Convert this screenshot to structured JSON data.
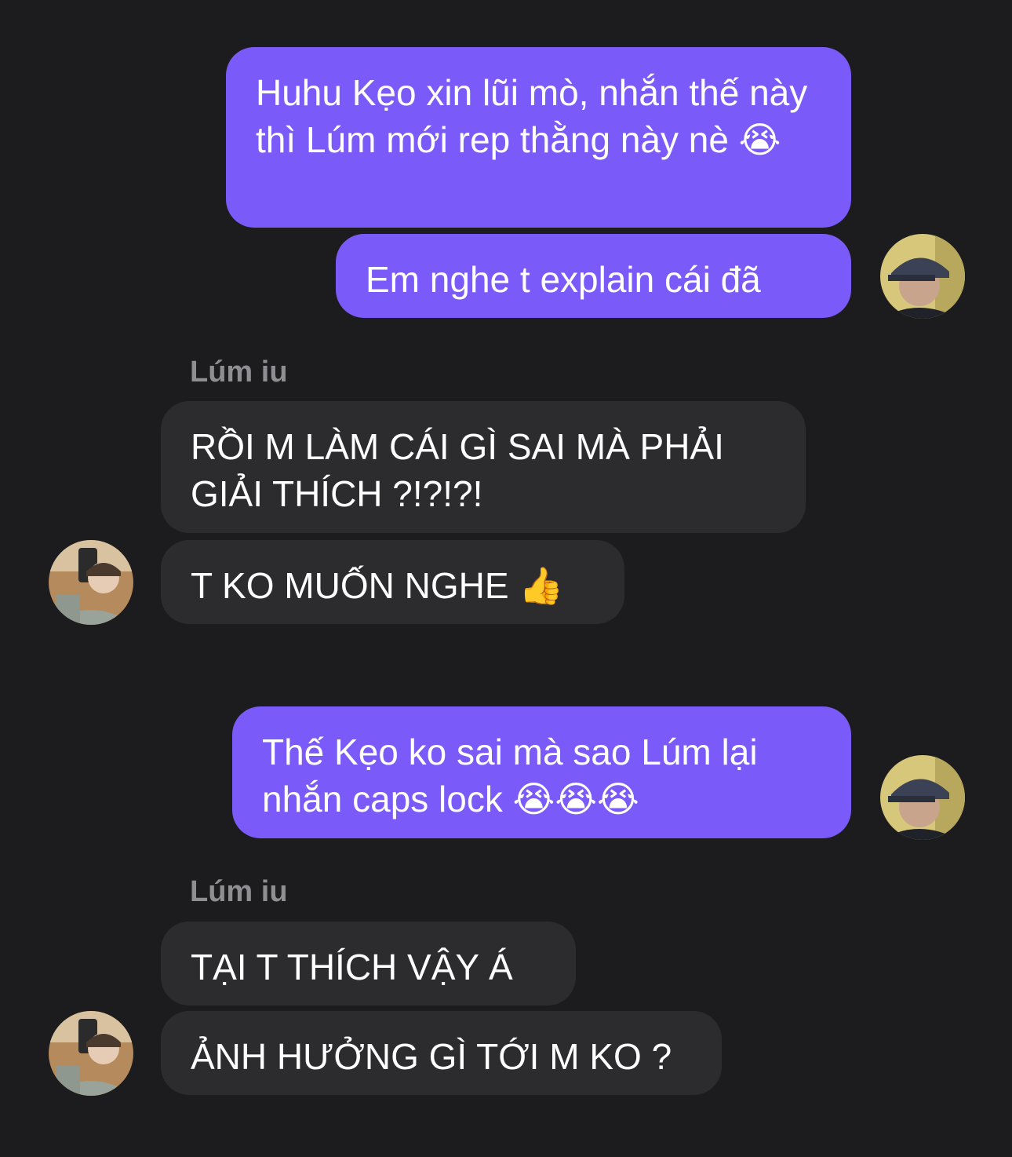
{
  "conversation": {
    "messages": [
      {
        "direction": "outgoing",
        "text": "Huhu Kẹo xin lũi mò, nhắn thế này thì Lúm mới rep thằng này nè 😭"
      },
      {
        "direction": "outgoing",
        "text": "Em nghe t explain cái đã"
      },
      {
        "direction": "incoming",
        "sender": "Lúm iu",
        "text": "RỒI M LÀM CÁI GÌ SAI MÀ PHẢI GIẢI THÍCH ?!?!?!"
      },
      {
        "direction": "incoming",
        "text": "T KO MUỐN NGHE 👍"
      },
      {
        "direction": "outgoing",
        "text": "Thế Kẹo ko sai mà sao Lúm lại nhắn caps lock 😭😭😭"
      },
      {
        "direction": "incoming",
        "sender": "Lúm iu",
        "text": "TẠI T THÍCH VẬY Á"
      },
      {
        "direction": "incoming",
        "text": "ẢNH HƯỞNG GÌ TỚI M KO ?"
      }
    ]
  },
  "colors": {
    "background": "#1c1c1e",
    "outgoing_bubble": "#7a5af8",
    "incoming_bubble": "#2c2c2e",
    "sender_name": "#8e8e93",
    "text": "#ffffff"
  },
  "icons": {
    "outgoing_avatar": "user-avatar-cap",
    "incoming_avatar": "user-avatar-selfie"
  }
}
